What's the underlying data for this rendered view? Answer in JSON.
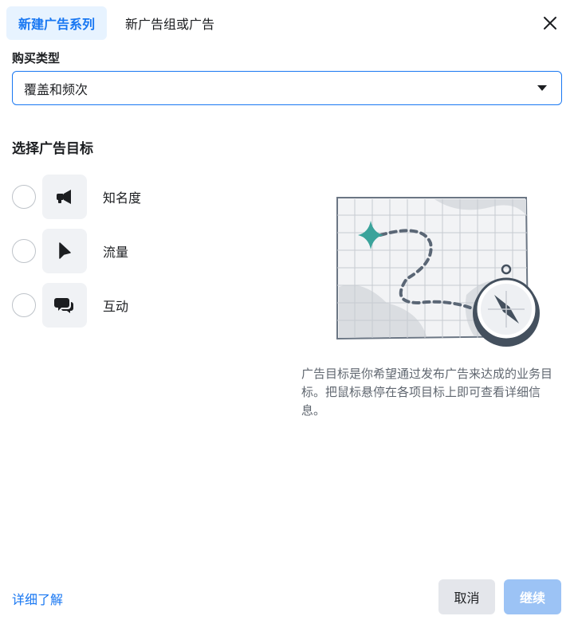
{
  "tabs": [
    {
      "label": "新建广告系列",
      "active": true
    },
    {
      "label": "新广告组或广告",
      "active": false
    }
  ],
  "buy_type": {
    "label": "购买类型",
    "selected": "覆盖和频次"
  },
  "objectives": {
    "title": "选择广告目标",
    "items": [
      {
        "label": "知名度",
        "icon": "megaphone-icon"
      },
      {
        "label": "流量",
        "icon": "cursor-icon"
      },
      {
        "label": "互动",
        "icon": "chat-bubbles-icon"
      }
    ]
  },
  "description": "广告目标是你希望通过发布广告来达成的业务目标。把鼠标悬停在各项目标上即可查看详细信息。",
  "footer": {
    "learn_more": "详细了解",
    "cancel": "取消",
    "continue": "继续"
  },
  "colors": {
    "accent": "#1877f2",
    "tab_active_bg": "#e7f3ff",
    "continue_disabled": "#9cc3f5",
    "map_star": "#3aa39b"
  }
}
